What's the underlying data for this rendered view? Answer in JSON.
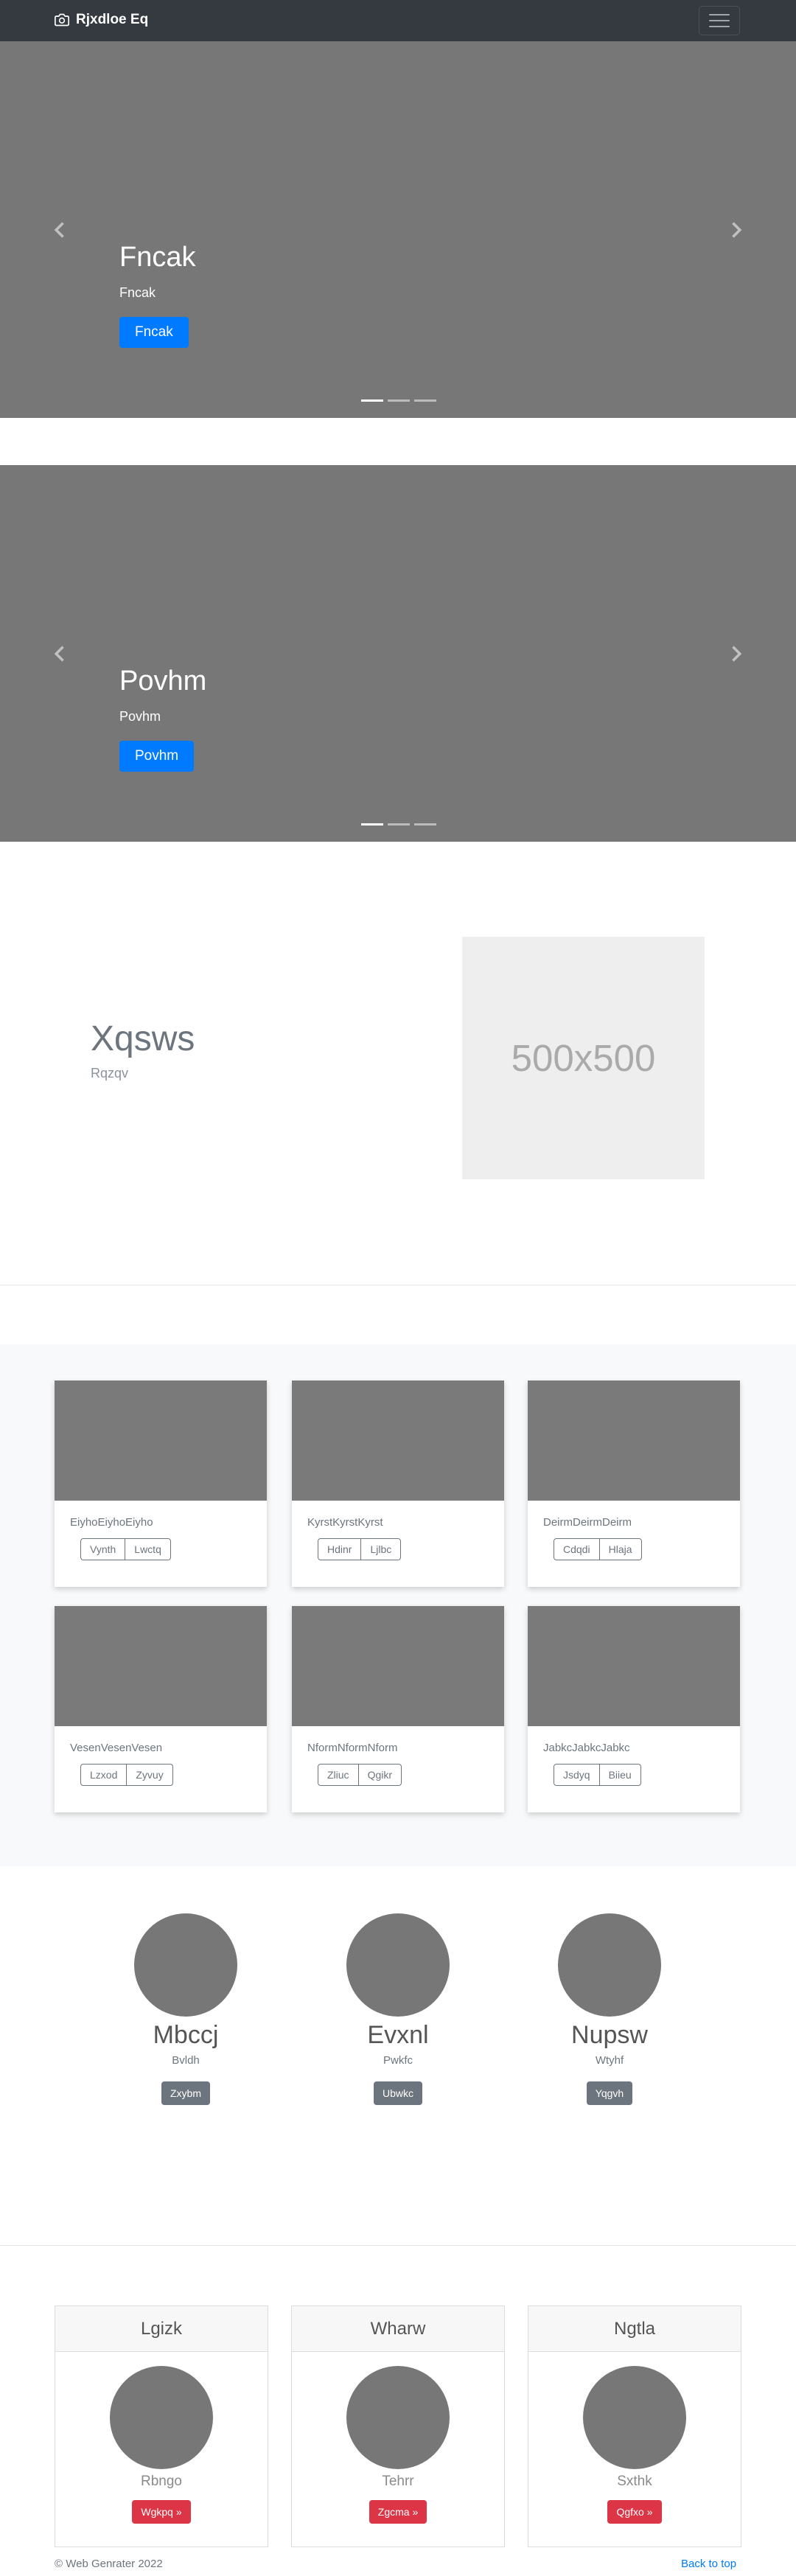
{
  "navbar": {
    "brand": "Rjxdloe Eq"
  },
  "carousels": [
    {
      "heading": "Fncak",
      "text": "Fncak",
      "button": "Fncak"
    },
    {
      "heading": "Povhm",
      "text": "Povhm",
      "button": "Povhm"
    }
  ],
  "featurette": {
    "heading": "Xqsws",
    "subheading": "Rqzqv",
    "image_label": "500x500"
  },
  "album": [
    {
      "text": "EiyhoEiyhoEiyho",
      "buttons": [
        "Vynth",
        "Lwctq"
      ]
    },
    {
      "text": "KyrstKyrstKyrst",
      "buttons": [
        "Hdinr",
        "Ljlbc"
      ]
    },
    {
      "text": "DeirmDeirmDeirm",
      "buttons": [
        "Cdqdi",
        "Hlaja"
      ]
    },
    {
      "text": "VesenVesenVesen",
      "buttons": [
        "Lzxod",
        "Zyvuy"
      ]
    },
    {
      "text": "NformNformNform",
      "buttons": [
        "Zliuc",
        "Qgikr"
      ]
    },
    {
      "text": "JabkcJabkcJabkc",
      "buttons": [
        "Jsdyq",
        "Biieu"
      ]
    }
  ],
  "marketing": [
    {
      "heading": "Mbccj",
      "text": "Bvldh",
      "button": "Zxybm"
    },
    {
      "heading": "Evxnl",
      "text": "Pwkfc",
      "button": "Ubwkc"
    },
    {
      "heading": "Nupsw",
      "text": "Wtyhf",
      "button": "Yqgvh"
    }
  ],
  "cards": [
    {
      "header": "Lgizk",
      "name": "Rbngo",
      "button": "Wgkpq »"
    },
    {
      "header": "Wharw",
      "name": "Tehrr",
      "button": "Zgcma »"
    },
    {
      "header": "Ngtla",
      "name": "Sxthk",
      "button": "Qgfxo »"
    }
  ],
  "footer": {
    "copyright": "© Web Genrater 2022",
    "back_to_top": "Back to top"
  }
}
